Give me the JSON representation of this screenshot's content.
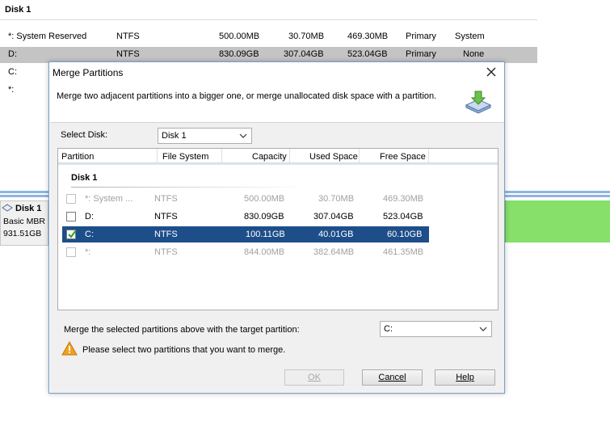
{
  "background": {
    "disk_title": "Disk 1",
    "rows": [
      {
        "partition": "*: System Reserved",
        "fs": "NTFS",
        "capacity": "500.00MB",
        "used": "30.70MB",
        "free": "469.30MB",
        "type": "Primary",
        "status": "System"
      },
      {
        "partition": "D:",
        "fs": "NTFS",
        "capacity": "830.09GB",
        "used": "307.04GB",
        "free": "523.04GB",
        "type": "Primary",
        "status": "None"
      },
      {
        "partition": "C:"
      },
      {
        "partition": "*:"
      }
    ],
    "disk_map": {
      "name": "Disk 1",
      "type": "Basic MBR",
      "size": "931.51GB"
    }
  },
  "dialog": {
    "title": "Merge Partitions",
    "description": "Merge two adjacent partitions into a bigger one, or merge unallocated disk space with a partition.",
    "select_disk_label": "Select Disk:",
    "select_disk_value": "Disk 1",
    "columns": [
      "Partition",
      "File System",
      "Capacity",
      "Used Space",
      "Free Space"
    ],
    "group_label": "Disk 1",
    "partitions": [
      {
        "name": "*: System ...",
        "fs": "NTFS",
        "capacity": "500.00MB",
        "used": "30.70MB",
        "free": "469.30MB",
        "checked": false,
        "enabled": false,
        "selected": false
      },
      {
        "name": "D:",
        "fs": "NTFS",
        "capacity": "830.09GB",
        "used": "307.04GB",
        "free": "523.04GB",
        "checked": false,
        "enabled": true,
        "selected": false
      },
      {
        "name": "C:",
        "fs": "NTFS",
        "capacity": "100.11GB",
        "used": "40.01GB",
        "free": "60.10GB",
        "checked": true,
        "enabled": true,
        "selected": true
      },
      {
        "name": "*:",
        "fs": "NTFS",
        "capacity": "844.00MB",
        "used": "382.64MB",
        "free": "461.35MB",
        "checked": false,
        "enabled": false,
        "selected": false
      }
    ],
    "merge_label": "Merge the selected partitions above with the target partition:",
    "target_value": "C:",
    "warning_text": "Please select two partitions that you want to merge.",
    "buttons": {
      "ok": "OK",
      "cancel": "Cancel",
      "help": "Help"
    }
  },
  "colors": {
    "selection": "#1e4e8a",
    "accent_green": "#86e06a",
    "warning": "#f0a020"
  }
}
